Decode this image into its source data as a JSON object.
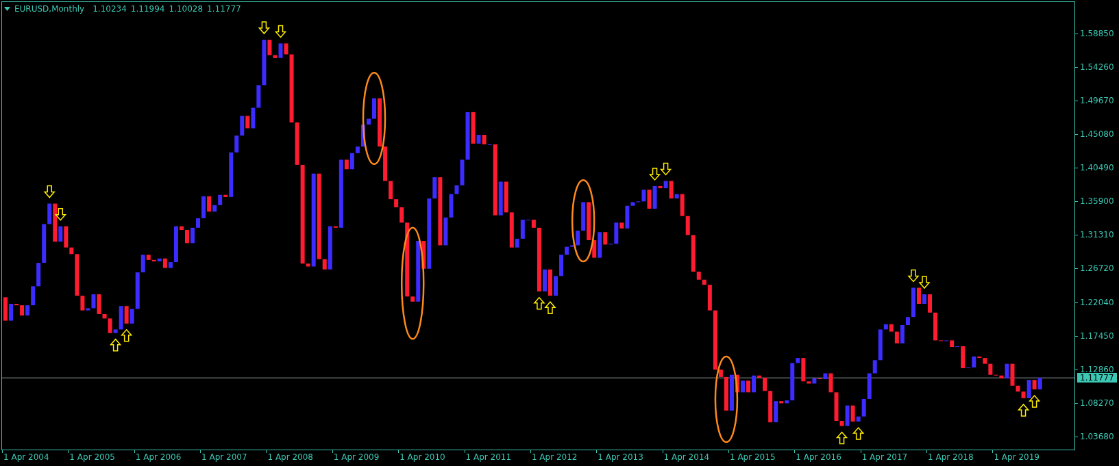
{
  "header": {
    "symbol": "EURUSD,Monthly",
    "ohlc": [
      "1.10234",
      "1.11994",
      "1.10028",
      "1.11777"
    ]
  },
  "price_axis": {
    "labels": [
      "1.58850",
      "1.54260",
      "1.49670",
      "1.45080",
      "1.40490",
      "1.35900",
      "1.31310",
      "1.26720",
      "1.22040",
      "1.17450",
      "1.12860",
      "1.08270",
      "1.03680"
    ],
    "current_price": "1.11777"
  },
  "time_axis": {
    "labels": [
      "1 Apr 2004",
      "1 Apr 2005",
      "1 Apr 2006",
      "1 Apr 2007",
      "1 Apr 2008",
      "1 Apr 2009",
      "1 Apr 2010",
      "1 Apr 2011",
      "1 Apr 2012",
      "1 Apr 2013",
      "1 Apr 2014",
      "1 Apr 2015",
      "1 Apr 2016",
      "1 Apr 2017",
      "1 Apr 2018",
      "1 Apr 2019"
    ]
  }
}
